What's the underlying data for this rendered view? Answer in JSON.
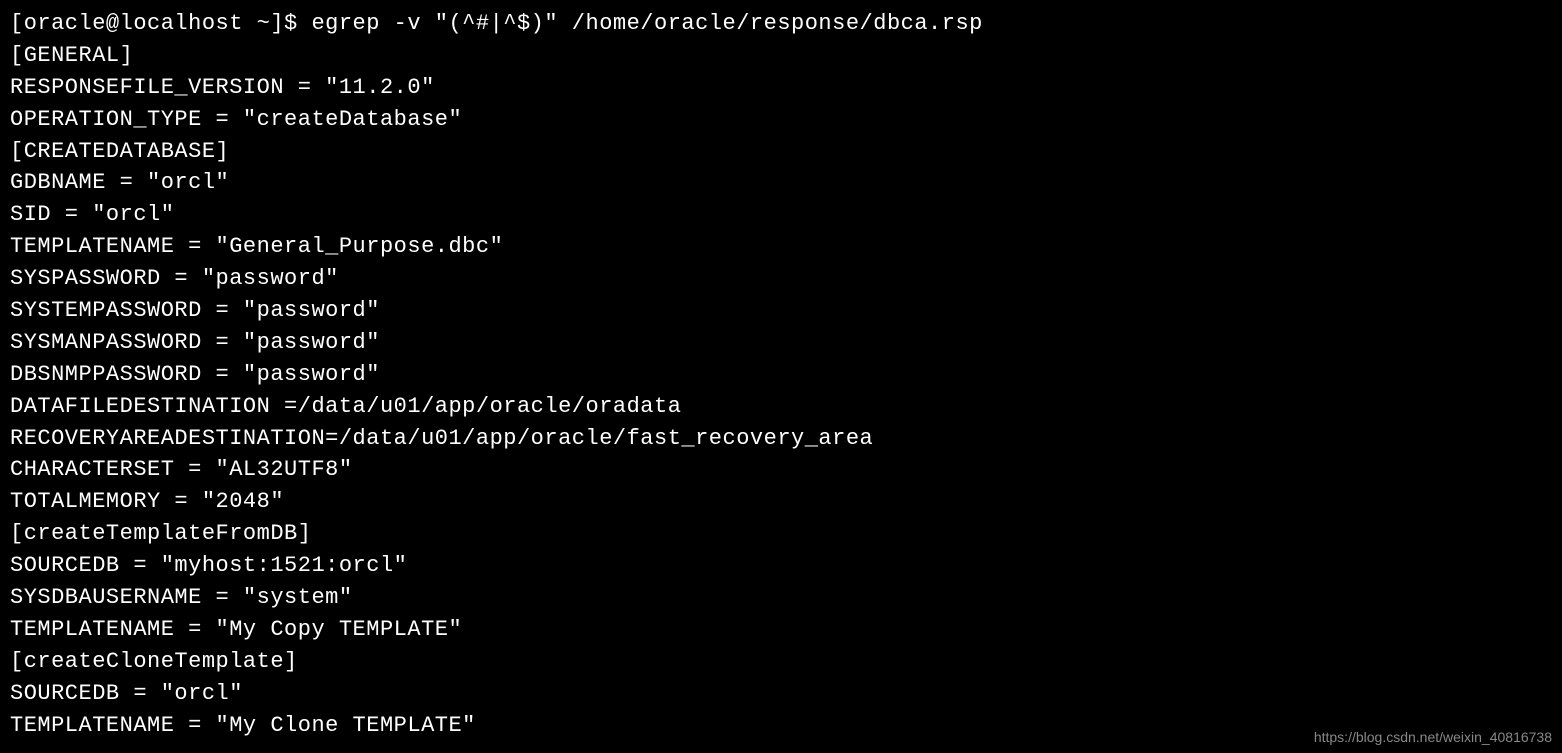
{
  "terminal": {
    "lines": [
      "[oracle@localhost ~]$ egrep -v \"(^#|^$)\" /home/oracle/response/dbca.rsp",
      "[GENERAL]",
      "RESPONSEFILE_VERSION = \"11.2.0\"",
      "OPERATION_TYPE = \"createDatabase\"",
      "[CREATEDATABASE]",
      "GDBNAME = \"orcl\"",
      "SID = \"orcl\"",
      "TEMPLATENAME = \"General_Purpose.dbc\"",
      "SYSPASSWORD = \"password\"",
      "SYSTEMPASSWORD = \"password\"",
      "SYSMANPASSWORD = \"password\"",
      "DBSNMPPASSWORD = \"password\"",
      "DATAFILEDESTINATION =/data/u01/app/oracle/oradata",
      "RECOVERYAREADESTINATION=/data/u01/app/oracle/fast_recovery_area",
      "CHARACTERSET = \"AL32UTF8\"",
      "TOTALMEMORY = \"2048\"",
      "[createTemplateFromDB]",
      "SOURCEDB = \"myhost:1521:orcl\"",
      "SYSDBAUSERNAME = \"system\"",
      "TEMPLATENAME = \"My Copy TEMPLATE\"",
      "[createCloneTemplate]",
      "SOURCEDB = \"orcl\"",
      "TEMPLATENAME = \"My Clone TEMPLATE\""
    ]
  },
  "watermark": {
    "text": "https://blog.csdn.net/weixin_40816738"
  }
}
